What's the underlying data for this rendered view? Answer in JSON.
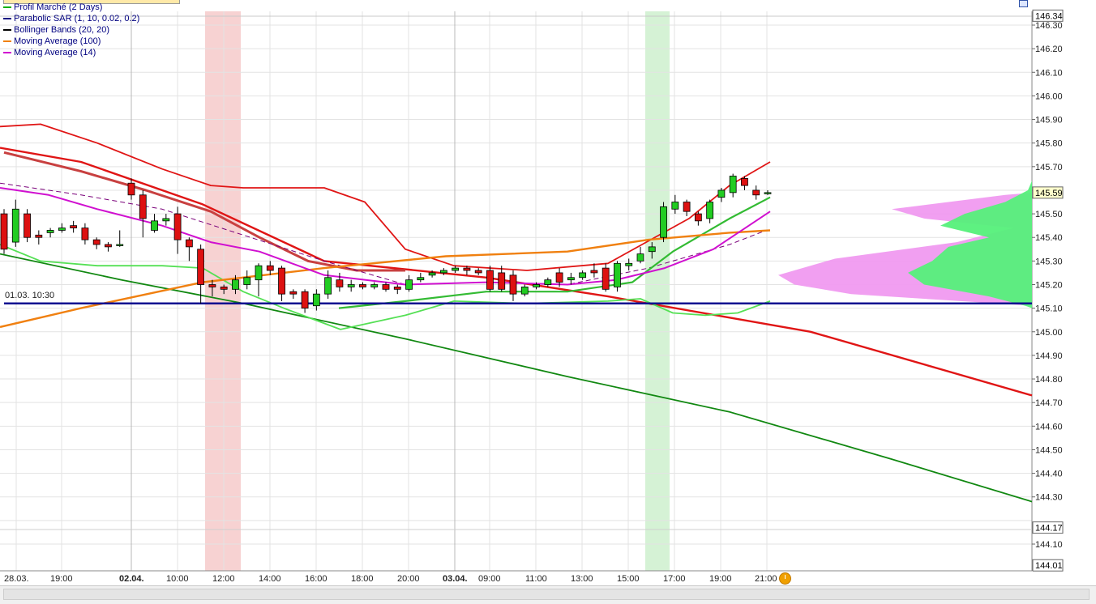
{
  "legend": [
    {
      "label": "Profil Marché (2 Days)",
      "color": "#00b000"
    },
    {
      "label": "Parabolic SAR  (1, 10, 0.02, 0.2)",
      "color": "#000080"
    },
    {
      "label": "Bollinger Bands  (20, 20)",
      "color": "#000000"
    },
    {
      "label": "Moving Average  (100)",
      "color": "#f08000"
    },
    {
      "label": "Moving Average  (14)",
      "color": "#d000d0"
    }
  ],
  "hline_label": "01.03. 10:30",
  "chart_data": {
    "type": "candlestick",
    "ylim": [
      144.0,
      146.35
    ],
    "y_ticks": [
      "146.30",
      "146.20",
      "146.10",
      "146.00",
      "145.90",
      "145.80",
      "145.70",
      "145.60",
      "145.50",
      "145.40",
      "145.30",
      "145.20",
      "145.10",
      "145.00",
      "144.90",
      "144.80",
      "144.70",
      "144.60",
      "144.50",
      "144.40",
      "144.30",
      "144.10"
    ],
    "price_boxes": [
      {
        "label": "146.34",
        "value": 146.34
      },
      {
        "label": "145.59",
        "value": 145.59
      },
      {
        "label": "144.17",
        "value": 144.17
      },
      {
        "label": "144.01",
        "value": 144.01
      }
    ],
    "x_labels": [
      {
        "label": "28.03.",
        "bold": false
      },
      {
        "label": "19:00",
        "bold": false
      },
      {
        "label": "02.04.",
        "bold": true
      },
      {
        "label": "10:00",
        "bold": false
      },
      {
        "label": "12:00",
        "bold": false
      },
      {
        "label": "14:00",
        "bold": false
      },
      {
        "label": "16:00",
        "bold": false
      },
      {
        "label": "18:00",
        "bold": false
      },
      {
        "label": "20:00",
        "bold": false
      },
      {
        "label": "03.04.",
        "bold": true
      },
      {
        "label": "09:00",
        "bold": false
      },
      {
        "label": "11:00",
        "bold": false
      },
      {
        "label": "13:00",
        "bold": false
      },
      {
        "label": "15:00",
        "bold": false
      },
      {
        "label": "17:00",
        "bold": false
      },
      {
        "label": "19:00",
        "bold": false
      },
      {
        "label": "21:00",
        "bold": false
      }
    ],
    "hline_value": 145.12,
    "colors": {
      "up": "#22cc22",
      "down": "#dd1111"
    },
    "candles": [
      [
        145.5,
        145.35,
        145.52,
        145.33
      ],
      [
        145.38,
        145.52,
        145.56,
        145.36
      ],
      [
        145.5,
        145.4,
        145.52,
        145.38
      ],
      [
        145.41,
        145.4,
        145.43,
        145.37
      ],
      [
        145.42,
        145.43,
        145.44,
        145.4
      ],
      [
        145.43,
        145.44,
        145.46,
        145.42
      ],
      [
        145.45,
        145.44,
        145.47,
        145.42
      ],
      [
        145.44,
        145.39,
        145.46,
        145.37
      ],
      [
        145.39,
        145.37,
        145.4,
        145.35
      ],
      [
        145.37,
        145.36,
        145.38,
        145.34
      ],
      [
        145.37,
        145.37,
        145.43,
        145.36
      ],
      [
        145.63,
        145.58,
        145.65,
        145.56
      ],
      [
        145.58,
        145.48,
        145.6,
        145.4
      ],
      [
        145.43,
        145.47,
        145.5,
        145.42
      ],
      [
        145.47,
        145.48,
        145.5,
        145.45
      ],
      [
        145.5,
        145.39,
        145.53,
        145.33
      ],
      [
        145.39,
        145.36,
        145.4,
        145.3
      ],
      [
        145.35,
        145.2,
        145.37,
        145.12
      ],
      [
        145.2,
        145.19,
        145.22,
        145.15
      ],
      [
        145.19,
        145.18,
        145.2,
        145.16
      ],
      [
        145.18,
        145.22,
        145.24,
        145.16
      ],
      [
        145.2,
        145.23,
        145.26,
        145.18
      ],
      [
        145.22,
        145.28,
        145.29,
        145.15
      ],
      [
        145.28,
        145.26,
        145.3,
        145.24
      ],
      [
        145.27,
        145.16,
        145.28,
        145.13
      ],
      [
        145.17,
        145.16,
        145.18,
        145.14
      ],
      [
        145.17,
        145.1,
        145.18,
        145.08
      ],
      [
        145.11,
        145.16,
        145.18,
        145.09
      ],
      [
        145.16,
        145.23,
        145.26,
        145.14
      ],
      [
        145.22,
        145.19,
        145.25,
        145.17
      ],
      [
        145.19,
        145.2,
        145.22,
        145.17
      ],
      [
        145.2,
        145.19,
        145.21,
        145.18
      ],
      [
        145.19,
        145.2,
        145.21,
        145.18
      ],
      [
        145.2,
        145.18,
        145.21,
        145.17
      ],
      [
        145.19,
        145.18,
        145.2,
        145.16
      ],
      [
        145.18,
        145.22,
        145.24,
        145.17
      ],
      [
        145.22,
        145.23,
        145.25,
        145.21
      ],
      [
        145.24,
        145.25,
        145.26,
        145.23
      ],
      [
        145.25,
        145.26,
        145.27,
        145.24
      ],
      [
        145.26,
        145.27,
        145.28,
        145.25
      ],
      [
        145.27,
        145.26,
        145.28,
        145.24
      ],
      [
        145.26,
        145.25,
        145.27,
        145.24
      ],
      [
        145.26,
        145.18,
        145.28,
        145.17
      ],
      [
        145.25,
        145.18,
        145.28,
        145.17
      ],
      [
        145.24,
        145.16,
        145.26,
        145.13
      ],
      [
        145.16,
        145.19,
        145.2,
        145.15
      ],
      [
        145.19,
        145.2,
        145.21,
        145.18
      ],
      [
        145.2,
        145.22,
        145.23,
        145.19
      ],
      [
        145.25,
        145.21,
        145.27,
        145.19
      ],
      [
        145.22,
        145.23,
        145.25,
        145.2
      ],
      [
        145.23,
        145.25,
        145.26,
        145.22
      ],
      [
        145.26,
        145.25,
        145.29,
        145.23
      ],
      [
        145.27,
        145.18,
        145.29,
        145.17
      ],
      [
        145.19,
        145.29,
        145.3,
        145.17
      ],
      [
        145.28,
        145.29,
        145.31,
        145.26
      ],
      [
        145.3,
        145.33,
        145.36,
        145.29
      ],
      [
        145.34,
        145.36,
        145.38,
        145.31
      ],
      [
        145.4,
        145.53,
        145.55,
        145.38
      ],
      [
        145.52,
        145.55,
        145.58,
        145.5
      ],
      [
        145.55,
        145.51,
        145.56,
        145.49
      ],
      [
        145.5,
        145.47,
        145.51,
        145.45
      ],
      [
        145.48,
        145.55,
        145.56,
        145.46
      ],
      [
        145.57,
        145.6,
        145.61,
        145.55
      ],
      [
        145.59,
        145.66,
        145.67,
        145.57
      ],
      [
        145.65,
        145.62,
        145.66,
        145.6
      ],
      [
        145.6,
        145.58,
        145.62,
        145.56
      ],
      [
        145.59,
        145.59,
        145.6,
        145.58
      ]
    ],
    "lines": {
      "trend_red": [
        [
          0,
          145.78
        ],
        [
          100,
          145.72
        ],
        [
          250,
          145.54
        ],
        [
          400,
          145.3
        ],
        [
          600,
          145.23
        ],
        [
          750,
          145.15
        ],
        [
          900,
          145.06
        ],
        [
          1000,
          145.0
        ],
        [
          1273,
          144.73
        ]
      ],
      "trend_green": [
        [
          0,
          145.33
        ],
        [
          150,
          145.22
        ],
        [
          300,
          145.12
        ],
        [
          500,
          144.97
        ],
        [
          700,
          144.81
        ],
        [
          900,
          144.66
        ],
        [
          1100,
          144.46
        ],
        [
          1273,
          144.28
        ]
      ],
      "ma100": [
        [
          0,
          145.02
        ],
        [
          100,
          145.1
        ],
        [
          250,
          145.21
        ],
        [
          400,
          145.27
        ],
        [
          550,
          145.32
        ],
        [
          700,
          145.34
        ],
        [
          800,
          145.39
        ],
        [
          900,
          145.42
        ],
        [
          950,
          145.43
        ]
      ],
      "ma14": [
        [
          0,
          145.61
        ],
        [
          60,
          145.58
        ],
        [
          120,
          145.52
        ],
        [
          200,
          145.45
        ],
        [
          260,
          145.38
        ],
        [
          320,
          145.34
        ],
        [
          400,
          145.24
        ],
        [
          500,
          145.2
        ],
        [
          600,
          145.21
        ],
        [
          700,
          145.2
        ],
        [
          760,
          145.22
        ],
        [
          820,
          145.27
        ],
        [
          880,
          145.35
        ],
        [
          950,
          145.51
        ]
      ],
      "bb_upper": [
        [
          0,
          145.87
        ],
        [
          50,
          145.88
        ],
        [
          120,
          145.8
        ],
        [
          200,
          145.69
        ],
        [
          260,
          145.62
        ],
        [
          300,
          145.61
        ],
        [
          400,
          145.61
        ],
        [
          450,
          145.55
        ],
        [
          500,
          145.35
        ],
        [
          560,
          145.28
        ],
        [
          650,
          145.26
        ],
        [
          750,
          145.29
        ],
        [
          850,
          145.48
        ],
        [
          900,
          145.62
        ],
        [
          950,
          145.72
        ]
      ],
      "bb_lower": [
        [
          0,
          145.37
        ],
        [
          50,
          145.3
        ],
        [
          120,
          145.28
        ],
        [
          200,
          145.28
        ],
        [
          250,
          145.27
        ],
        [
          300,
          145.17
        ],
        [
          350,
          145.1
        ],
        [
          420,
          145.01
        ],
        [
          500,
          145.07
        ],
        [
          560,
          145.13
        ],
        [
          650,
          145.12
        ],
        [
          750,
          145.13
        ],
        [
          790,
          145.14
        ],
        [
          830,
          145.08
        ],
        [
          870,
          145.07
        ],
        [
          910,
          145.08
        ],
        [
          950,
          145.13
        ]
      ],
      "bb_mid_dash": [
        [
          0,
          145.63
        ],
        [
          100,
          145.58
        ],
        [
          200,
          145.52
        ],
        [
          300,
          145.41
        ],
        [
          400,
          145.3
        ],
        [
          500,
          145.2
        ],
        [
          600,
          145.21
        ],
        [
          700,
          145.2
        ],
        [
          800,
          145.27
        ],
        [
          900,
          145.37
        ],
        [
          945,
          145.43
        ]
      ],
      "bb_mid_green": [
        [
          418,
          145.1
        ],
        [
          500,
          145.13
        ],
        [
          600,
          145.17
        ],
        [
          700,
          145.17
        ],
        [
          780,
          145.21
        ],
        [
          830,
          145.34
        ],
        [
          900,
          145.48
        ],
        [
          950,
          145.57
        ]
      ],
      "sar_thick": [
        [
          5,
          145.76
        ],
        [
          100,
          145.68
        ],
        [
          180,
          145.6
        ],
        [
          260,
          145.51
        ],
        [
          320,
          145.4
        ],
        [
          380,
          145.3
        ],
        [
          440,
          145.26
        ],
        [
          500,
          145.26
        ]
      ],
      "profile_green": [
        [
          1273,
          145.64
        ],
        [
          1268,
          145.6
        ],
        [
          1240,
          145.55
        ],
        [
          1190,
          145.5
        ],
        [
          1160,
          145.45
        ],
        [
          1220,
          145.4
        ],
        [
          1170,
          145.36
        ],
        [
          1150,
          145.3
        ],
        [
          1120,
          145.25
        ],
        [
          1140,
          145.2
        ],
        [
          1220,
          145.15
        ],
        [
          1265,
          145.11
        ],
        [
          1273,
          145.1
        ]
      ],
      "profile_pink": [
        [
          1273,
          145.59
        ],
        [
          1240,
          145.58
        ],
        [
          1100,
          145.52
        ],
        [
          1140,
          145.48
        ],
        [
          1250,
          145.44
        ],
        [
          1180,
          145.38
        ],
        [
          1030,
          145.31
        ],
        [
          960,
          145.24
        ],
        [
          980,
          145.2
        ],
        [
          1050,
          145.16
        ],
        [
          1230,
          145.12
        ],
        [
          1273,
          145.11
        ]
      ]
    },
    "shaded_regions": [
      {
        "color": "#f7d2d2",
        "x0_label": "12:00"
      },
      {
        "color": "#d5f2d5",
        "x0_label": "17:00"
      }
    ],
    "grid": true
  }
}
